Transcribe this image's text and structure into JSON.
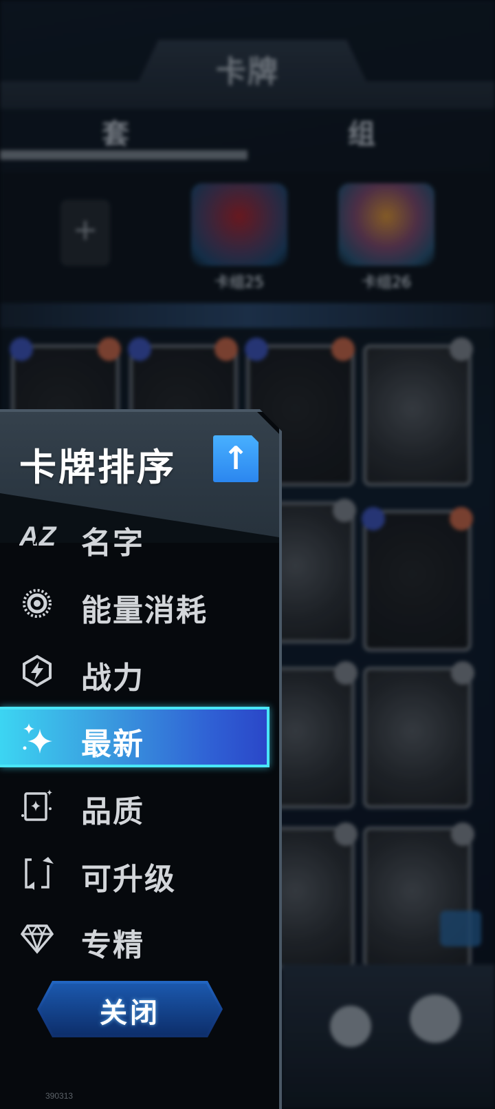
{
  "background": {
    "title": "卡牌",
    "tabs": [
      "套",
      "组"
    ],
    "decks": [
      "卡组25",
      "卡组26"
    ]
  },
  "sort_panel": {
    "title": "卡牌排序",
    "direction_icon": "up-arrow-icon",
    "items": [
      {
        "label": "名字",
        "icon": "az-icon"
      },
      {
        "label": "能量消耗",
        "icon": "energy-icon"
      },
      {
        "label": "战力",
        "icon": "power-icon"
      },
      {
        "label": "最新",
        "icon": "sparkle-icon"
      },
      {
        "label": "品质",
        "icon": "quality-icon"
      },
      {
        "label": "可升级",
        "icon": "upgrade-icon"
      },
      {
        "label": "专精",
        "icon": "diamond-icon"
      }
    ],
    "selected_index": 3,
    "close_label": "关闭"
  },
  "build_id": "390313",
  "colors": {
    "accent": "#3a9bdf",
    "highlight": "#49e6f8",
    "panel_bg": "#06090d"
  }
}
